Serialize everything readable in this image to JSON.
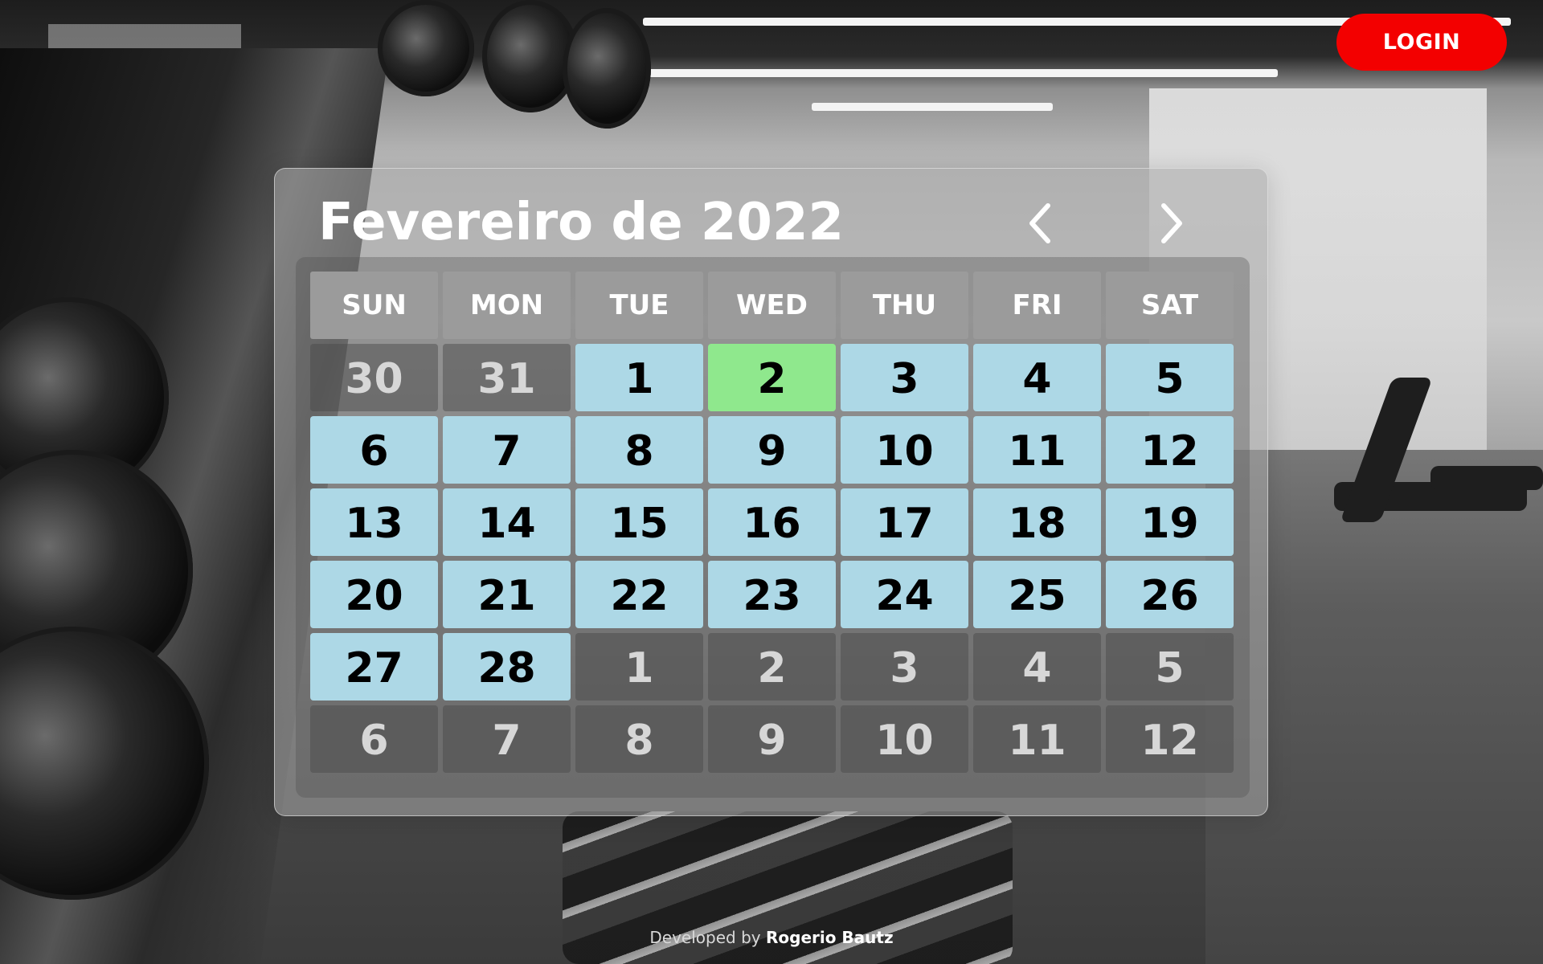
{
  "header": {
    "login_label": "LOGIN"
  },
  "calendar": {
    "title": "Fevereiro de 2022",
    "prev_icon": "chevron-left-icon",
    "next_icon": "chevron-right-icon",
    "weekdays": [
      "SUN",
      "MON",
      "TUE",
      "WED",
      "THU",
      "FRI",
      "SAT"
    ],
    "days": [
      {
        "label": "30",
        "type": "other"
      },
      {
        "label": "31",
        "type": "other"
      },
      {
        "label": "1",
        "type": "current"
      },
      {
        "label": "2",
        "type": "today"
      },
      {
        "label": "3",
        "type": "current"
      },
      {
        "label": "4",
        "type": "current"
      },
      {
        "label": "5",
        "type": "current"
      },
      {
        "label": "6",
        "type": "current"
      },
      {
        "label": "7",
        "type": "current"
      },
      {
        "label": "8",
        "type": "current"
      },
      {
        "label": "9",
        "type": "current"
      },
      {
        "label": "10",
        "type": "current"
      },
      {
        "label": "11",
        "type": "current"
      },
      {
        "label": "12",
        "type": "current"
      },
      {
        "label": "13",
        "type": "current"
      },
      {
        "label": "14",
        "type": "current"
      },
      {
        "label": "15",
        "type": "current"
      },
      {
        "label": "16",
        "type": "current"
      },
      {
        "label": "17",
        "type": "current"
      },
      {
        "label": "18",
        "type": "current"
      },
      {
        "label": "19",
        "type": "current"
      },
      {
        "label": "20",
        "type": "current"
      },
      {
        "label": "21",
        "type": "current"
      },
      {
        "label": "22",
        "type": "current"
      },
      {
        "label": "23",
        "type": "current"
      },
      {
        "label": "24",
        "type": "current"
      },
      {
        "label": "25",
        "type": "current"
      },
      {
        "label": "26",
        "type": "current"
      },
      {
        "label": "27",
        "type": "current"
      },
      {
        "label": "28",
        "type": "current"
      },
      {
        "label": "1",
        "type": "other"
      },
      {
        "label": "2",
        "type": "other"
      },
      {
        "label": "3",
        "type": "other"
      },
      {
        "label": "4",
        "type": "other"
      },
      {
        "label": "5",
        "type": "other"
      },
      {
        "label": "6",
        "type": "other"
      },
      {
        "label": "7",
        "type": "other"
      },
      {
        "label": "8",
        "type": "other"
      },
      {
        "label": "9",
        "type": "other"
      },
      {
        "label": "10",
        "type": "other"
      },
      {
        "label": "11",
        "type": "other"
      },
      {
        "label": "12",
        "type": "other"
      }
    ]
  },
  "footer": {
    "prefix": "Developed by",
    "author": "Rogerio Bautz"
  },
  "colors": {
    "login": "#f30000",
    "current_day": "#add8e6",
    "today": "#8fe88d",
    "weekday_header": "#9b9b9b"
  }
}
